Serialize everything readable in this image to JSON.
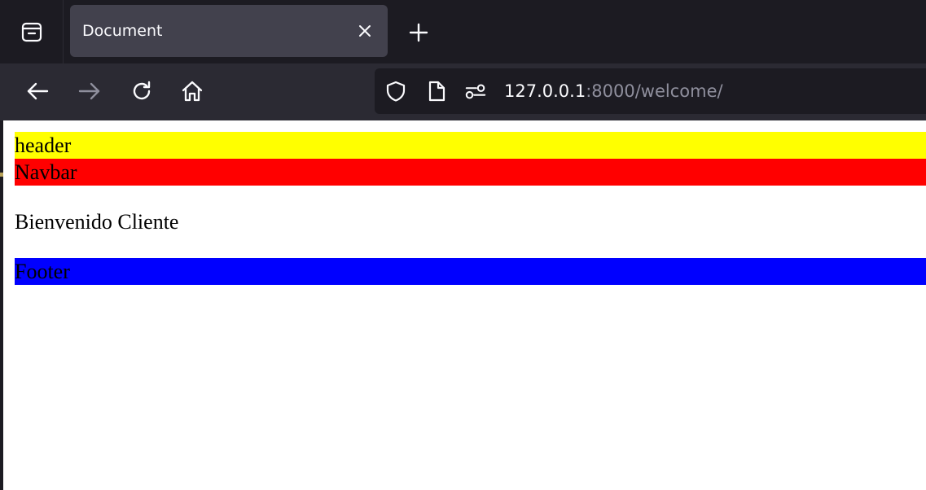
{
  "browser": {
    "tab": {
      "title": "Document"
    },
    "url": {
      "host": "127.0.0.1",
      "path": ":8000/welcome/"
    },
    "icons": {
      "tab_manager": "tab-manager-icon",
      "close": "close-icon",
      "new_tab": "plus-icon",
      "back": "back-arrow-icon",
      "forward": "forward-arrow-icon",
      "reload": "reload-icon",
      "home": "home-icon",
      "tracking": "shield-icon",
      "page_info": "document-icon",
      "permissions": "permissions-icon"
    },
    "colors": {
      "tabstrip_bg": "#1c1b22",
      "toolbar_bg": "#2b2a33",
      "active_tab_bg": "#42414d",
      "url_dim": "#8f8f9d"
    }
  },
  "page": {
    "header": "header",
    "navbar": "Navbar",
    "welcome": "Bienvenido Cliente",
    "footer": "Footer",
    "colors": {
      "header_bg": "#ffff00",
      "navbar_bg": "#ff0000",
      "footer_bg": "#0000ff"
    }
  }
}
